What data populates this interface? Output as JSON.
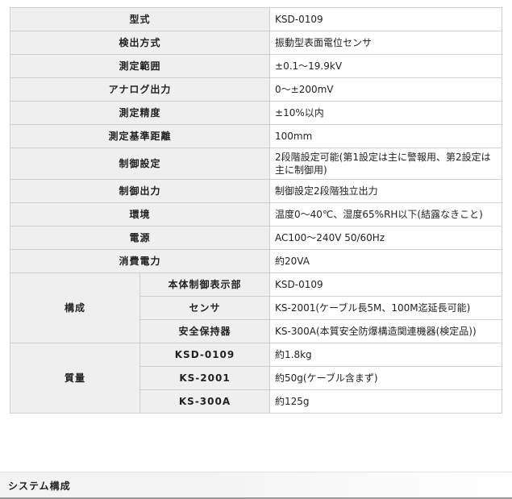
{
  "spec_table": {
    "rows": [
      {
        "label": "型式",
        "value": "KSD-0109"
      },
      {
        "label": "検出方式",
        "value": "振動型表面電位センサ"
      },
      {
        "label": "測定範囲",
        "value": "±0.1～19.9kV"
      },
      {
        "label": "アナログ出力",
        "value": "0～±200mV"
      },
      {
        "label": "測定精度",
        "value": "±10%以内"
      },
      {
        "label": "測定基準距離",
        "value": "100mm"
      },
      {
        "label": "制御設定",
        "value": "2段階設定可能(第1設定は主に警報用、第2設定は主に制御用)"
      },
      {
        "label": "制御出力",
        "value": "制御設定2段階独立出力"
      },
      {
        "label": "環境",
        "value": "温度0～40℃、湿度65%RH以下(結露なきこと)"
      },
      {
        "label": "電源",
        "value": "AC100～240V 50/60Hz"
      },
      {
        "label": "消費電力",
        "value": "約20VA"
      }
    ],
    "composition": {
      "label": "構成",
      "items": [
        {
          "label": "本体制御表示部",
          "value": "KSD-0109"
        },
        {
          "label": "センサ",
          "value": "KS-2001(ケーブル長5M、100M迄延長可能)"
        },
        {
          "label": "安全保持器",
          "value": "KS-300A(本質安全防爆構造関連機器(検定品))"
        }
      ]
    },
    "mass": {
      "label": "質量",
      "items": [
        {
          "label": "KSD-0109",
          "value": "約1.8kg"
        },
        {
          "label": "KS-2001",
          "value": "約50g(ケーブル含まず)"
        },
        {
          "label": "KS-300A",
          "value": "約125g"
        }
      ]
    }
  },
  "section": {
    "title": "システム構成"
  },
  "colors": {
    "label_bg": "#efefef",
    "border": "#cfcfcf",
    "section_line": "#999999"
  }
}
